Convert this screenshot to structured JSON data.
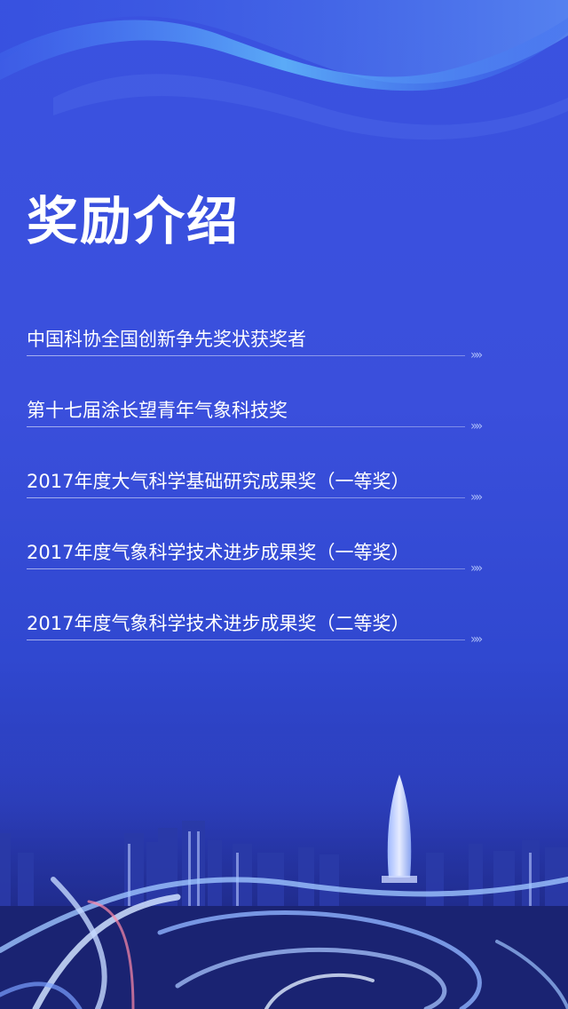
{
  "page": {
    "title": "奖励介绍"
  },
  "awards": [
    {
      "label": "中国科协全国创新争先奖状获奖者",
      "arrow": "»»"
    },
    {
      "label": "第十七届涂长望青年气象科技奖",
      "arrow": "»»"
    },
    {
      "label": "2017年度大气科学基础研究成果奖（一等奖）",
      "arrow": "»»"
    },
    {
      "label": "2017年度气象科学技术进步成果奖（一等奖）",
      "arrow": "»»"
    },
    {
      "label": "2017年度气象科学技术进步成果奖（二等奖）",
      "arrow": "»»"
    }
  ],
  "colors": {
    "background": "#3a4fdc",
    "text": "#ffffff",
    "wave": "#5aa8ff"
  }
}
